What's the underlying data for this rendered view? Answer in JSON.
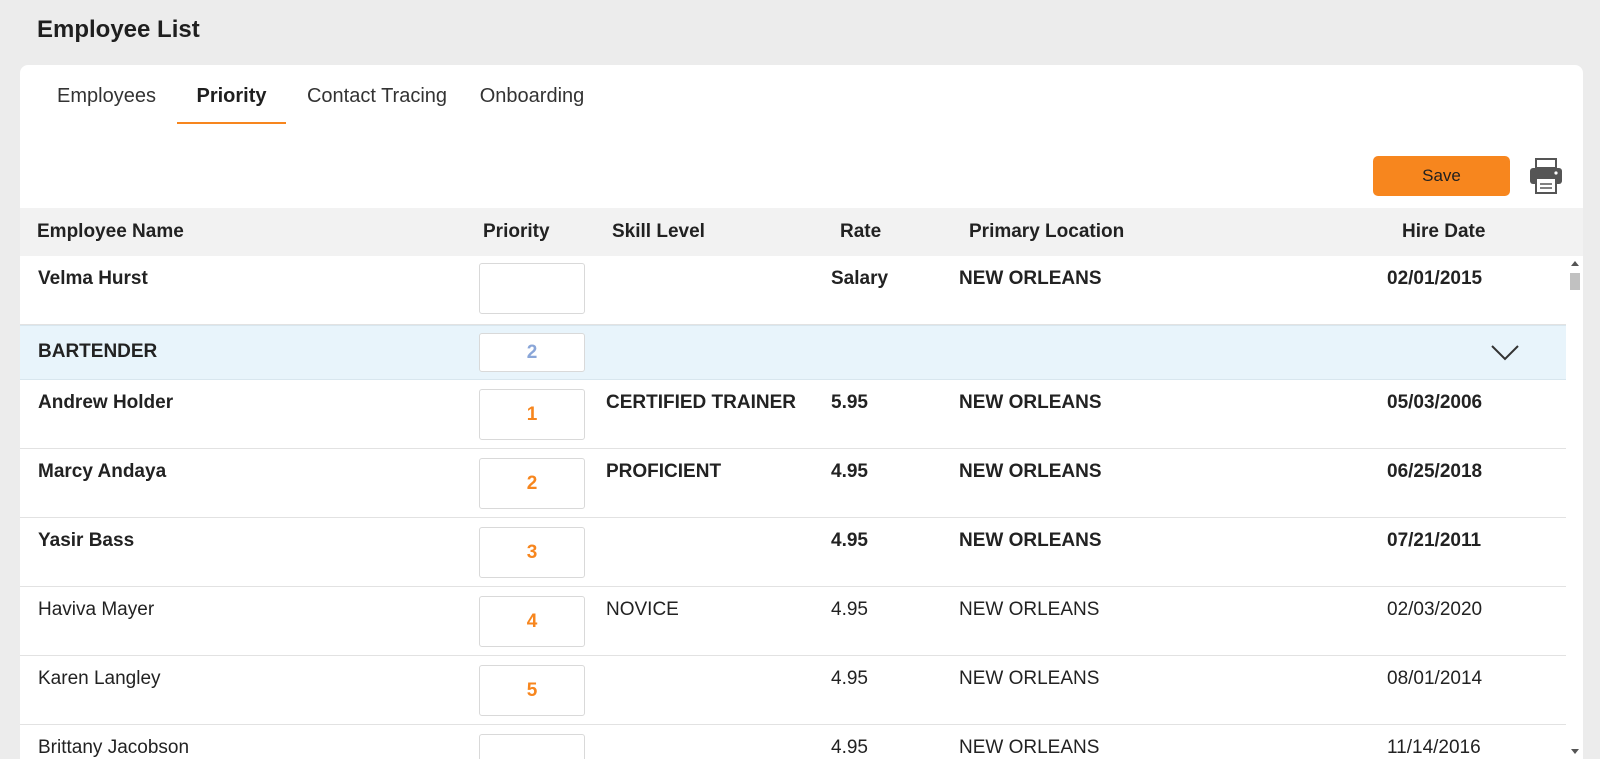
{
  "page": {
    "title": "Employee List"
  },
  "tabs": [
    {
      "label": "Employees",
      "active": false
    },
    {
      "label": "Priority",
      "active": true
    },
    {
      "label": "Contact Tracing",
      "active": false
    },
    {
      "label": "Onboarding",
      "active": false
    }
  ],
  "toolbar": {
    "save_label": "Save",
    "print_icon": "printer-icon"
  },
  "colors": {
    "accent": "#f7861e",
    "group_row_bg": "#e8f4fb",
    "header_bg": "#f2f2f2"
  },
  "table": {
    "columns": [
      "Employee Name",
      "Priority",
      "Skill Level",
      "Rate",
      "Primary Location",
      "Hire Date"
    ],
    "rows": [
      {
        "type": "employee",
        "bold": true,
        "name": "Velma Hurst",
        "priority": "",
        "skill": "",
        "rate": "Salary",
        "location": "NEW ORLEANS",
        "hire_date": "02/01/2015"
      },
      {
        "type": "group",
        "name": "BARTENDER",
        "priority": "2",
        "expanded": true
      },
      {
        "type": "employee",
        "bold": true,
        "name": "Andrew Holder",
        "priority": "1",
        "skill": "CERTIFIED TRAINER",
        "rate": "5.95",
        "location": "NEW ORLEANS",
        "hire_date": "05/03/2006"
      },
      {
        "type": "employee",
        "bold": true,
        "name": "Marcy Andaya",
        "priority": "2",
        "skill": "PROFICIENT",
        "rate": "4.95",
        "location": "NEW ORLEANS",
        "hire_date": "06/25/2018"
      },
      {
        "type": "employee",
        "bold": true,
        "name": "Yasir Bass",
        "priority": "3",
        "skill": "",
        "rate": "4.95",
        "location": "NEW ORLEANS",
        "hire_date": "07/21/2011"
      },
      {
        "type": "employee",
        "bold": false,
        "name": "Haviva Mayer",
        "priority": "4",
        "skill": "NOVICE",
        "rate": "4.95",
        "location": "NEW ORLEANS",
        "hire_date": "02/03/2020"
      },
      {
        "type": "employee",
        "bold": false,
        "name": "Karen Langley",
        "priority": "5",
        "skill": "",
        "rate": "4.95",
        "location": "NEW ORLEANS",
        "hire_date": "08/01/2014"
      },
      {
        "type": "employee",
        "bold": false,
        "name": "Brittany Jacobson",
        "priority": "",
        "skill": "",
        "rate": "4.95",
        "location": "NEW ORLEANS",
        "hire_date": "11/14/2016"
      }
    ]
  }
}
